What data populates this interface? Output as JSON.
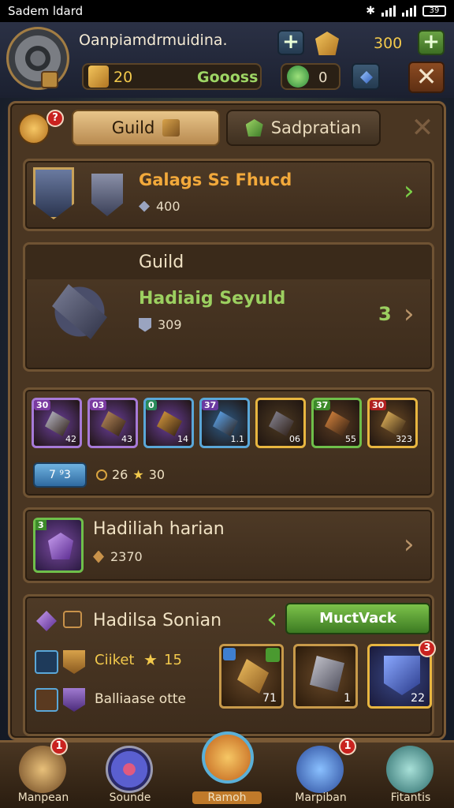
{
  "status_bar": {
    "carrier": "Sadem ldard",
    "battery": "39"
  },
  "header": {
    "player_name": "Oanpiamdrmuidina.",
    "gold_value": "300",
    "gems_value": "20",
    "center_label": "Goooss",
    "green_value": "0"
  },
  "tabs": [
    {
      "label": "Guild",
      "active": true
    },
    {
      "label": "Sadpratian",
      "active": false
    }
  ],
  "badges": {
    "corner": "?"
  },
  "card1": {
    "title": "Galags Ss Fhucd",
    "value": "400"
  },
  "card2": {
    "header": "Guild",
    "title": "Hadiaig Seyuld",
    "value": "309",
    "count": "3"
  },
  "items": {
    "slots": [
      {
        "level": "30",
        "count": "42",
        "border": "#a77ad8",
        "bg": "#6b3f9c"
      },
      {
        "level": "03",
        "count": "43",
        "border": "#a77ad8",
        "bg": "#6b3f9c"
      },
      {
        "level": "0",
        "count": "14",
        "border": "#5aa7d8",
        "bg": "#6b3f9c"
      },
      {
        "level": "37",
        "count": "1.1",
        "border": "#5aa7d8",
        "bg": "#2e5b86"
      },
      {
        "level": "",
        "count": "06",
        "border": "#e8b640",
        "bg": "#4d3a22"
      },
      {
        "level": "37",
        "count": "55",
        "border": "#6fbf4a",
        "bg": "#5a3c22"
      },
      {
        "level": "30",
        "count": "323",
        "border": "#e8b640",
        "bg": "#6a4a24"
      }
    ],
    "info_pill": "7 ⁹3",
    "info_coin": "26",
    "info_star": "30"
  },
  "card4": {
    "title": "Hadiliah harian",
    "value": "2370",
    "level": "3"
  },
  "card5": {
    "title": "Hadilsa Sonian",
    "button": "MuctVack",
    "row1_label": "Ciiket",
    "row1_value": "15",
    "row2_label": "Balliaase otte",
    "slot_counts": [
      "71",
      "1",
      "22"
    ],
    "slot_badge": "3"
  },
  "nav": [
    {
      "label": "Manpean",
      "badge": "1",
      "color": "#c6934c"
    },
    {
      "label": "Sounde",
      "badge": "",
      "color": "#5a5fd0"
    },
    {
      "label": "Ramoh",
      "badge": "",
      "color": "#e28b2a"
    },
    {
      "label": "Marpiban",
      "badge": "1",
      "color": "#3a7fd0"
    },
    {
      "label": "Fitantis",
      "badge": "",
      "color": "#4aa0a0"
    }
  ]
}
